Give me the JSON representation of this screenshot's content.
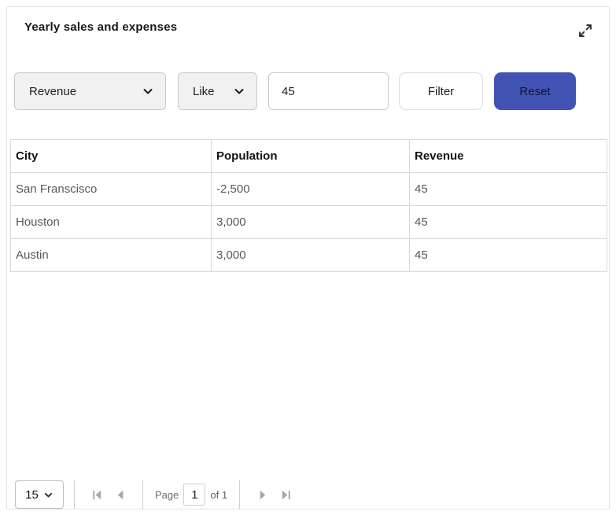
{
  "panel": {
    "title": "Yearly sales and expenses"
  },
  "filter_bar": {
    "field_select": {
      "value": "Revenue"
    },
    "operator_select": {
      "value": "Like"
    },
    "value_input": {
      "value": "45",
      "placeholder": ""
    },
    "filter_button_label": "Filter",
    "reset_button_label": "Reset"
  },
  "table": {
    "columns": [
      "City",
      "Population",
      "Revenue"
    ],
    "rows": [
      [
        "San Franscisco",
        "-2,500",
        "45"
      ],
      [
        "Houston",
        "3,000",
        "45"
      ],
      [
        "Austin",
        "3,000",
        "45"
      ]
    ]
  },
  "pagination": {
    "page_size_select": {
      "value": "15"
    },
    "page_label": "Page",
    "page_input": {
      "value": "1"
    },
    "total_pages_label": "of 1"
  },
  "icons": {
    "expand": "expand-diagonal-arrows",
    "chevron_down": "chevron-down",
    "first_page": "bar-left-triangle",
    "prev_page": "left-triangle",
    "next_page": "right-triangle",
    "last_page": "right-triangle-bar"
  },
  "colors": {
    "accent": "#4353b4",
    "panel_border": "#e4e4e4",
    "table_border": "#d9d9d9",
    "control_bg": "#f1f1f1",
    "muted_icon": "#a6a6a6",
    "cell_text": "#55595c",
    "heading_text": "#141414"
  }
}
